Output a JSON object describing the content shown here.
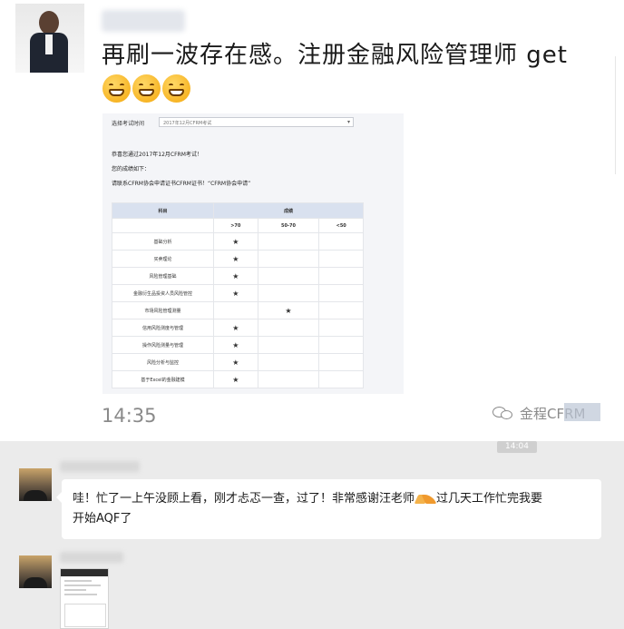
{
  "post": {
    "text": "再刷一波存在感。注册金融风险管理师 get",
    "time": "14:35",
    "watermark": "金程CFRM",
    "emoji_icon": "grinning-face-emoji",
    "emoji_count": 3
  },
  "results_page": {
    "select_label": "选择考试时间",
    "select_value": "2017年12月CFRM考试",
    "pass_line": "恭喜您通过2017年12月CFRM考试！",
    "performance_label": "您的成绩如下：",
    "next_line": "请联系CFRM协会申请证书CFRM证书！“CFRM协会申请”",
    "table": {
      "header_topic": "科目",
      "header_score": "成绩",
      "bands": [
        ">70",
        "50-70",
        "<50"
      ],
      "rows": [
        {
          "topic": "基础分析",
          "band": 0
        },
        {
          "topic": "买卖理论",
          "band": 0
        },
        {
          "topic": "风险管理基础",
          "band": 0
        },
        {
          "topic": "金融衍生品投资人员风险管控",
          "band": 0
        },
        {
          "topic": "市场风险管理测量",
          "band": 1
        },
        {
          "topic": "信用风险测度与管理",
          "band": 0
        },
        {
          "topic": "操作风险测量与管理",
          "band": 0
        },
        {
          "topic": "风险分析与监控",
          "band": 0
        },
        {
          "topic": "基于Excel的金融建模",
          "band": 0
        }
      ],
      "mark": "★"
    }
  },
  "chat": {
    "timestamp": "14:04",
    "message_part1": "哇！忙了一上午没顾上看，刚才忐忑一查，过了！非常感谢汪老师",
    "message_part2": "过几天工作忙完我要",
    "message_line2": "开始AQF了",
    "inline_icon": "folded-hands-emoji"
  }
}
